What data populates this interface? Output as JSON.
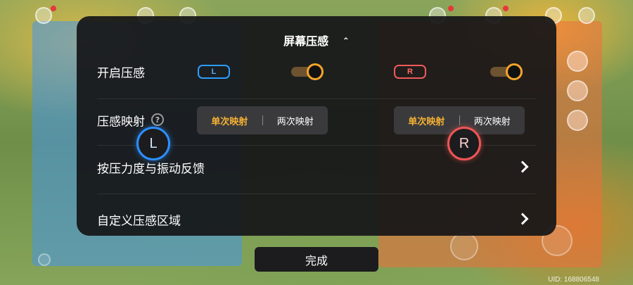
{
  "panel": {
    "title": "屏幕压感",
    "title_chevron": "^",
    "rows": {
      "enable": {
        "label": "开启压感"
      },
      "mapping": {
        "label": "压感映射"
      },
      "force": {
        "label": "按压力度与振动反馈"
      },
      "region": {
        "label": "自定义压感区域"
      }
    },
    "left": {
      "badge": "L",
      "toggle_on": true,
      "mapping_options": [
        "单次映射",
        "两次映射"
      ],
      "mapping_selected": "单次映射"
    },
    "right": {
      "badge": "R",
      "toggle_on": true,
      "mapping_options": [
        "单次映射",
        "两次映射"
      ],
      "mapping_selected": "单次映射"
    },
    "info_icon": "?"
  },
  "sticks": {
    "left": "L",
    "right": "R"
  },
  "done_button": "完成",
  "uid": "UID: 168806548",
  "colors": {
    "accent": "#f3a52b",
    "left": "#2d9cff",
    "right": "#f05a5a",
    "panel_bg": "#161618"
  },
  "icons": {
    "chevron": "chevron-up-icon",
    "info": "question-circle-icon",
    "arrow": "chevron-right-icon"
  }
}
